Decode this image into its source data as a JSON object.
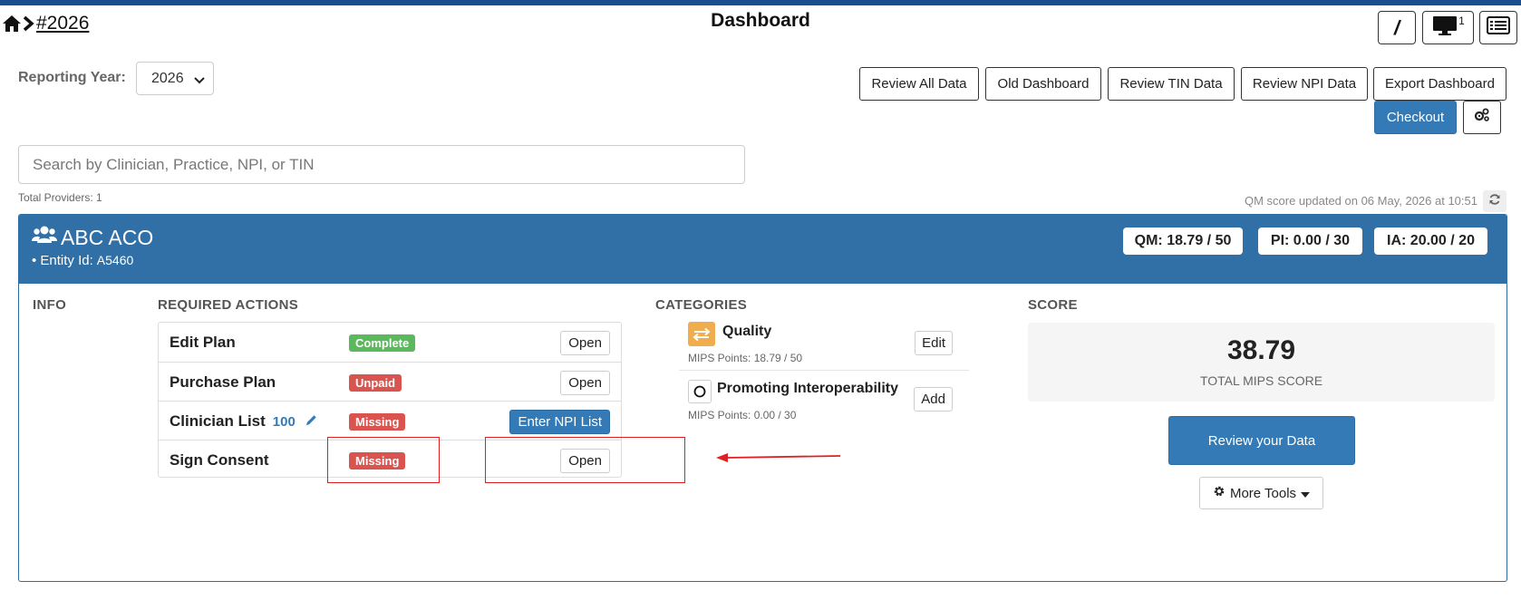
{
  "header": {
    "breadcrumb_link": "#2026",
    "title": "Dashboard",
    "tools": [
      {
        "name": "slash-tool",
        "label": "/"
      },
      {
        "name": "monitor-tool",
        "badge": "1"
      },
      {
        "name": "list-tool"
      }
    ]
  },
  "reporting_year": {
    "label": "Reporting Year:",
    "value": "2026"
  },
  "toolbar": {
    "review_all": "Review All Data",
    "old_dashboard": "Old Dashboard",
    "review_tin": "Review TIN Data",
    "review_npi": "Review NPI Data",
    "export": "Export Dashboard",
    "checkout": "Checkout"
  },
  "search": {
    "placeholder": "Search by Clinician, Practice, NPI, or TIN",
    "value": ""
  },
  "total_providers": "Total Providers: 1",
  "qm_updated": "QM score updated on 06 May, 2026 at 10:51",
  "entity": {
    "name": "ABC ACO",
    "id_label": "• Entity Id:",
    "id_value": "A5460",
    "scores": {
      "qm": "QM: 18.79 / 50",
      "pi": "PI: 0.00 / 30",
      "ia": "IA: 20.00 / 20"
    }
  },
  "columns": {
    "info": "INFO",
    "required_actions": "REQUIRED ACTIONS",
    "categories": "CATEGORIES",
    "score": "SCORE"
  },
  "actions": [
    {
      "name": "Edit Plan",
      "status": "Complete",
      "status_color": "#5cb85c",
      "button": "Open"
    },
    {
      "name": "Purchase Plan",
      "status": "Unpaid",
      "status_color": "#d9534f",
      "button": "Open"
    },
    {
      "name": "Clinician List",
      "count": "100",
      "status": "Missing",
      "status_color": "#d9534f",
      "button": "Enter NPI List"
    },
    {
      "name": "Sign Consent",
      "status": "Missing",
      "status_color": "#d9534f",
      "button": "Open"
    }
  ],
  "categories": [
    {
      "title": "Quality",
      "points": "MIPS Points: 18.79 / 50",
      "button": "Edit",
      "icon": "exchange-icon",
      "icon_color": "#f0ad4e"
    },
    {
      "title": "Promoting Interoperability",
      "points": "MIPS Points: 0.00 / 30",
      "button": "Add",
      "icon": "circle-icon"
    }
  ],
  "score": {
    "value": "38.79",
    "label": "TOTAL MIPS SCORE",
    "review_button": "Review your Data",
    "more_tools": "More Tools"
  },
  "colors": {
    "primary": "#337ab7",
    "panel_header": "#3070a6",
    "top_bar": "#1a4f8f",
    "annotation": "#e02020"
  }
}
